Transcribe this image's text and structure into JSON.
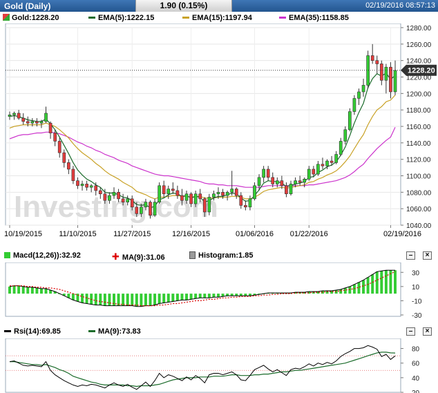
{
  "header": {
    "title": "Gold (Daily)",
    "change": "1.90 (0.15%)",
    "datetime": "02/19/2016 08:57:13"
  },
  "legends": {
    "main": [
      {
        "label": "Gold:1228.20",
        "color": "#e23d3d"
      },
      {
        "label": "EMA(5):1222.15",
        "color": "#1a6b2a"
      },
      {
        "label": "EMA(15):1197.94",
        "color": "#c9a227"
      },
      {
        "label": "EMA(35):1158.85",
        "color": "#cc33cc"
      }
    ],
    "macd": [
      {
        "label": "Macd(12,26)):32.92",
        "color": "#33cc33"
      },
      {
        "label": "MA(9):31.06",
        "color": "#dd0000"
      },
      {
        "label": "Histogram:1.85",
        "color": "#9a9a9a"
      }
    ],
    "rsi": [
      {
        "label": "Rsi(14):69.85",
        "color": "#000000"
      },
      {
        "label": "MA(9):73.83",
        "color": "#1a6b2a"
      }
    ]
  },
  "controls": {
    "minimize": "–",
    "close": "×"
  },
  "watermark": "Investing.com",
  "current_price_tag": "1228.20",
  "chart_data": {
    "type": "candlestick",
    "x_labels": [
      "10/19/2015",
      "11/10/2015",
      "11/27/2015",
      "12/16/2015",
      "01/06/2016",
      "01/22/2016",
      "02/19/2016"
    ],
    "x_label_index": [
      0,
      15,
      27,
      40,
      54,
      66,
      84
    ],
    "ylim": [
      1040,
      1280
    ],
    "yticks": [
      1040,
      1060,
      1080,
      1100,
      1120,
      1140,
      1160,
      1180,
      1200,
      1220,
      1240,
      1260,
      1280
    ],
    "current_price": 1228.2,
    "candles": [
      [
        1172,
        1178,
        1168,
        1174
      ],
      [
        1174,
        1178,
        1168,
        1176
      ],
      [
        1176,
        1180,
        1168,
        1170
      ],
      [
        1170,
        1176,
        1162,
        1166
      ],
      [
        1166,
        1172,
        1160,
        1164
      ],
      [
        1164,
        1170,
        1160,
        1166
      ],
      [
        1166,
        1170,
        1160,
        1164
      ],
      [
        1164,
        1168,
        1158,
        1166
      ],
      [
        1166,
        1184,
        1164,
        1176
      ],
      [
        1164,
        1166,
        1145,
        1152
      ],
      [
        1152,
        1156,
        1136,
        1142
      ],
      [
        1142,
        1146,
        1122,
        1128
      ],
      [
        1128,
        1132,
        1110,
        1116
      ],
      [
        1116,
        1120,
        1102,
        1108
      ],
      [
        1108,
        1112,
        1090,
        1094
      ],
      [
        1094,
        1098,
        1084,
        1088
      ],
      [
        1088,
        1094,
        1082,
        1090
      ],
      [
        1090,
        1094,
        1082,
        1086
      ],
      [
        1086,
        1090,
        1080,
        1088
      ],
      [
        1088,
        1092,
        1076,
        1082
      ],
      [
        1082,
        1086,
        1072,
        1078
      ],
      [
        1078,
        1084,
        1066,
        1070
      ],
      [
        1070,
        1080,
        1066,
        1076
      ],
      [
        1076,
        1086,
        1072,
        1080
      ],
      [
        1080,
        1084,
        1068,
        1072
      ],
      [
        1072,
        1078,
        1064,
        1068
      ],
      [
        1068,
        1076,
        1064,
        1072
      ],
      [
        1072,
        1076,
        1058,
        1062
      ],
      [
        1062,
        1068,
        1050,
        1054
      ],
      [
        1054,
        1066,
        1050,
        1062
      ],
      [
        1062,
        1072,
        1058,
        1068
      ],
      [
        1068,
        1070,
        1048,
        1052
      ],
      [
        1052,
        1072,
        1050,
        1068
      ],
      [
        1068,
        1092,
        1066,
        1088
      ],
      [
        1088,
        1094,
        1074,
        1078
      ],
      [
        1078,
        1088,
        1072,
        1084
      ],
      [
        1084,
        1092,
        1078,
        1082
      ],
      [
        1082,
        1088,
        1072,
        1076
      ],
      [
        1076,
        1084,
        1064,
        1070
      ],
      [
        1070,
        1082,
        1066,
        1078
      ],
      [
        1078,
        1080,
        1062,
        1066
      ],
      [
        1066,
        1082,
        1062,
        1078
      ],
      [
        1078,
        1084,
        1068,
        1072
      ],
      [
        1072,
        1074,
        1050,
        1056
      ],
      [
        1056,
        1078,
        1052,
        1074
      ],
      [
        1074,
        1082,
        1070,
        1078
      ],
      [
        1078,
        1086,
        1072,
        1080
      ],
      [
        1080,
        1084,
        1072,
        1076
      ],
      [
        1076,
        1082,
        1070,
        1080
      ],
      [
        1080,
        1106,
        1076,
        1084
      ],
      [
        1084,
        1086,
        1072,
        1076
      ],
      [
        1076,
        1080,
        1060,
        1064
      ],
      [
        1064,
        1070,
        1058,
        1062
      ],
      [
        1062,
        1076,
        1058,
        1072
      ],
      [
        1072,
        1092,
        1070,
        1088
      ],
      [
        1088,
        1102,
        1082,
        1098
      ],
      [
        1098,
        1112,
        1092,
        1108
      ],
      [
        1108,
        1112,
        1094,
        1098
      ],
      [
        1098,
        1104,
        1086,
        1090
      ],
      [
        1090,
        1098,
        1086,
        1094
      ],
      [
        1094,
        1100,
        1084,
        1088
      ],
      [
        1088,
        1092,
        1074,
        1078
      ],
      [
        1078,
        1094,
        1076,
        1090
      ],
      [
        1090,
        1098,
        1086,
        1094
      ],
      [
        1094,
        1100,
        1088,
        1092
      ],
      [
        1092,
        1098,
        1086,
        1096
      ],
      [
        1096,
        1112,
        1094,
        1108
      ],
      [
        1108,
        1112,
        1098,
        1102
      ],
      [
        1102,
        1118,
        1100,
        1114
      ],
      [
        1114,
        1122,
        1108,
        1112
      ],
      [
        1112,
        1120,
        1108,
        1118
      ],
      [
        1118,
        1124,
        1112,
        1116
      ],
      [
        1116,
        1130,
        1114,
        1126
      ],
      [
        1126,
        1146,
        1124,
        1142
      ],
      [
        1142,
        1160,
        1138,
        1156
      ],
      [
        1156,
        1182,
        1154,
        1178
      ],
      [
        1178,
        1198,
        1174,
        1194
      ],
      [
        1194,
        1206,
        1186,
        1202
      ],
      [
        1202,
        1218,
        1196,
        1210
      ],
      [
        1210,
        1252,
        1206,
        1246
      ],
      [
        1246,
        1260,
        1236,
        1240
      ],
      [
        1240,
        1246,
        1224,
        1236
      ],
      [
        1236,
        1240,
        1210,
        1216
      ],
      [
        1216,
        1236,
        1200,
        1232
      ],
      [
        1232,
        1238,
        1194,
        1202
      ],
      [
        1202,
        1240,
        1198,
        1228
      ]
    ],
    "ema5": [
      1172,
      1173,
      1172,
      1170,
      1168,
      1167,
      1166,
      1166,
      1169,
      1163,
      1156,
      1147,
      1137,
      1127,
      1116,
      1107,
      1101,
      1096,
      1093,
      1089,
      1086,
      1080,
      1079,
      1079,
      1077,
      1074,
      1073,
      1070,
      1065,
      1064,
      1065,
      1061,
      1063,
      1071,
      1073,
      1077,
      1079,
      1078,
      1075,
      1076,
      1073,
      1075,
      1074,
      1068,
      1070,
      1073,
      1075,
      1075,
      1077,
      1079,
      1078,
      1073,
      1069,
      1070,
      1076,
      1083,
      1091,
      1094,
      1093,
      1093,
      1091,
      1087,
      1088,
      1090,
      1091,
      1093,
      1098,
      1099,
      1104,
      1107,
      1111,
      1113,
      1117,
      1125,
      1135,
      1149,
      1164,
      1177,
      1188,
      1207,
      1218,
      1224,
      1221,
      1225,
      1217,
      1222
    ],
    "ema15": [
      1158,
      1160,
      1161,
      1162,
      1162,
      1162,
      1162,
      1162,
      1164,
      1162,
      1160,
      1156,
      1151,
      1146,
      1139,
      1133,
      1128,
      1124,
      1120,
      1115,
      1111,
      1106,
      1102,
      1099,
      1096,
      1092,
      1089,
      1086,
      1081,
      1079,
      1077,
      1074,
      1072,
      1074,
      1074,
      1075,
      1076,
      1076,
      1075,
      1075,
      1074,
      1075,
      1075,
      1073,
      1073,
      1073,
      1074,
      1074,
      1074,
      1075,
      1075,
      1074,
      1072,
      1072,
      1074,
      1077,
      1081,
      1083,
      1084,
      1085,
      1086,
      1085,
      1086,
      1087,
      1088,
      1089,
      1092,
      1093,
      1096,
      1098,
      1101,
      1103,
      1106,
      1111,
      1117,
      1124,
      1133,
      1142,
      1150,
      1162,
      1172,
      1180,
      1184,
      1190,
      1192,
      1198
    ],
    "ema35": [
      1145,
      1147,
      1149,
      1150,
      1150,
      1151,
      1152,
      1152,
      1153,
      1153,
      1152,
      1151,
      1149,
      1147,
      1144,
      1141,
      1139,
      1136,
      1134,
      1131,
      1129,
      1126,
      1124,
      1122,
      1119,
      1117,
      1115,
      1112,
      1110,
      1108,
      1106,
      1104,
      1102,
      1101,
      1100,
      1100,
      1099,
      1098,
      1097,
      1096,
      1095,
      1094,
      1093,
      1091,
      1090,
      1090,
      1089,
      1089,
      1088,
      1088,
      1088,
      1087,
      1086,
      1086,
      1086,
      1086,
      1087,
      1088,
      1088,
      1088,
      1088,
      1088,
      1088,
      1088,
      1088,
      1088,
      1089,
      1089,
      1090,
      1091,
      1092,
      1093,
      1094,
      1096,
      1098,
      1101,
      1105,
      1110,
      1114,
      1121,
      1127,
      1133,
      1138,
      1143,
      1147,
      1159
    ],
    "macd_ylim": [
      -30,
      40
    ],
    "macd_yticks": [
      30,
      10,
      -10,
      -30
    ],
    "macd": [
      10,
      11,
      11,
      10,
      9,
      9,
      8,
      7,
      7,
      5,
      3,
      0,
      -3,
      -6,
      -9,
      -11,
      -13,
      -14,
      -15,
      -16,
      -16,
      -17,
      -17,
      -17,
      -17,
      -17,
      -17,
      -17,
      -18,
      -18,
      -17,
      -17,
      -16,
      -14,
      -13,
      -12,
      -11,
      -10,
      -9,
      -9,
      -8,
      -7,
      -6,
      -6,
      -6,
      -5,
      -5,
      -4,
      -3,
      -3,
      -3,
      -3,
      -3,
      -3,
      -2,
      -1,
      0,
      1,
      1,
      1,
      1,
      1,
      1,
      2,
      2,
      2,
      3,
      3,
      3,
      4,
      4,
      4,
      5,
      6,
      8,
      10,
      13,
      16,
      19,
      23,
      27,
      31,
      32,
      33,
      33,
      32.92
    ],
    "macd_signal": [
      11,
      11,
      11,
      11,
      10,
      10,
      9,
      9,
      8,
      8,
      7,
      6,
      4,
      2,
      0,
      -2,
      -4,
      -6,
      -8,
      -10,
      -11,
      -12,
      -13,
      -14,
      -15,
      -15,
      -16,
      -16,
      -16,
      -17,
      -17,
      -17,
      -17,
      -16,
      -16,
      -15,
      -14,
      -14,
      -13,
      -12,
      -11,
      -10,
      -10,
      -9,
      -8,
      -8,
      -7,
      -6,
      -6,
      -5,
      -5,
      -4,
      -4,
      -4,
      -3,
      -3,
      -2,
      -2,
      -1,
      -1,
      0,
      0,
      0,
      1,
      1,
      1,
      1,
      2,
      2,
      2,
      3,
      3,
      3,
      4,
      5,
      6,
      7,
      9,
      11,
      13,
      16,
      19,
      22,
      25,
      28,
      31.06
    ],
    "rsi_ylim": [
      20,
      90
    ],
    "rsi_yticks": [
      80,
      60,
      40,
      20
    ],
    "rsi_level_lines": [
      70,
      50
    ],
    "rsi": [
      62,
      63,
      60,
      57,
      56,
      57,
      56,
      55,
      62,
      50,
      44,
      40,
      36,
      33,
      30,
      28,
      30,
      29,
      31,
      30,
      28,
      26,
      30,
      33,
      30,
      28,
      31,
      27,
      24,
      29,
      34,
      28,
      36,
      46,
      40,
      44,
      42,
      39,
      36,
      41,
      37,
      43,
      39,
      33,
      44,
      46,
      46,
      44,
      46,
      48,
      44,
      37,
      36,
      43,
      51,
      54,
      57,
      52,
      48,
      51,
      47,
      43,
      51,
      53,
      52,
      55,
      59,
      56,
      60,
      58,
      61,
      59,
      63,
      69,
      73,
      76,
      80,
      80,
      81,
      84,
      82,
      79,
      69,
      72,
      65,
      69.85
    ],
    "rsi_ma": [
      62,
      62,
      61,
      60,
      59,
      58,
      58,
      57,
      58,
      56,
      54,
      51,
      49,
      46,
      42,
      40,
      38,
      36,
      34,
      33,
      31,
      30,
      30,
      30,
      30,
      30,
      29,
      29,
      28,
      29,
      29,
      29,
      30,
      31,
      33,
      35,
      37,
      38,
      39,
      40,
      40,
      40,
      41,
      41,
      41,
      42,
      42,
      42,
      43,
      44,
      44,
      43,
      43,
      43,
      44,
      44,
      45,
      45,
      46,
      47,
      48,
      48,
      49,
      50,
      50,
      51,
      52,
      53,
      54,
      55,
      56,
      57,
      58,
      59,
      60,
      62,
      64,
      66,
      68,
      70,
      72,
      74,
      75,
      75,
      74,
      73.83
    ]
  }
}
